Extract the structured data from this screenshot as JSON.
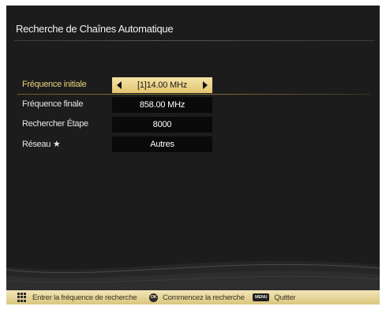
{
  "screen": {
    "title": "Recherche de Chaînes Automatique"
  },
  "settings": [
    {
      "label": "Fréquence initiale",
      "value": "[1]14.00 MHz"
    },
    {
      "label": "Fréquence finale",
      "value": "858.00 MHz"
    },
    {
      "label": "Rechercher Étape",
      "value": "8000"
    },
    {
      "label": "Réseau ★",
      "value": "Autres"
    }
  ],
  "footer": {
    "keypad_label": "Entrer la fréquence de recherche",
    "ok_key": "OK",
    "ok_label": "Commencez la recherche",
    "menu_key": "MENU",
    "menu_label": "Quitter"
  },
  "colors": {
    "background": "#1c1c1c",
    "selected_label": "#e9d27a",
    "active_field": "#f2dc92",
    "footer": "#e8d898"
  },
  "icons": [
    "caret-left-icon",
    "caret-right-icon",
    "keypad-icon",
    "ok-button-icon",
    "menu-button-icon"
  ]
}
